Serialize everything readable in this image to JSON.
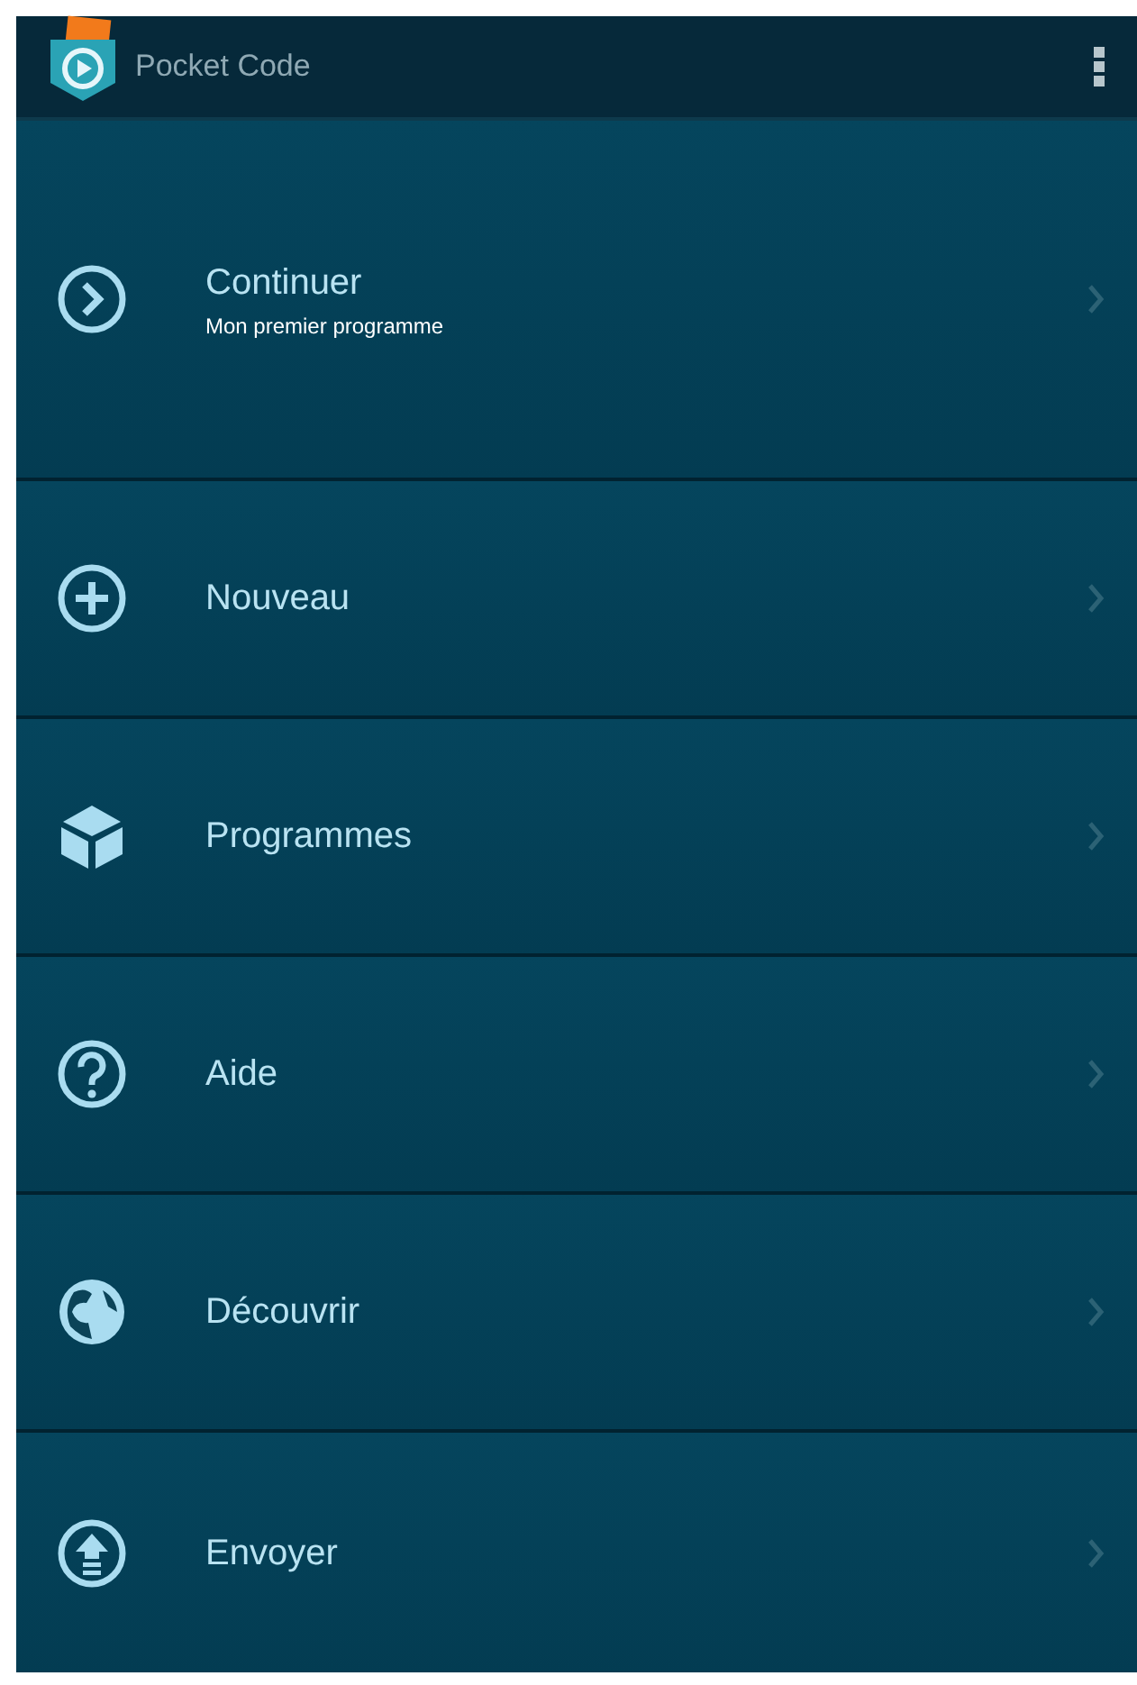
{
  "app_bar": {
    "title": "Pocket Code"
  },
  "menu": [
    {
      "kind": "continue",
      "label": "Continuer",
      "subtitle": "Mon premier programme"
    },
    {
      "kind": "new",
      "label": "Nouveau"
    },
    {
      "kind": "programs",
      "label": "Programmes"
    },
    {
      "kind": "help",
      "label": "Aide"
    },
    {
      "kind": "explore",
      "label": "Découvrir"
    },
    {
      "kind": "upload",
      "label": "Envoyer"
    }
  ]
}
